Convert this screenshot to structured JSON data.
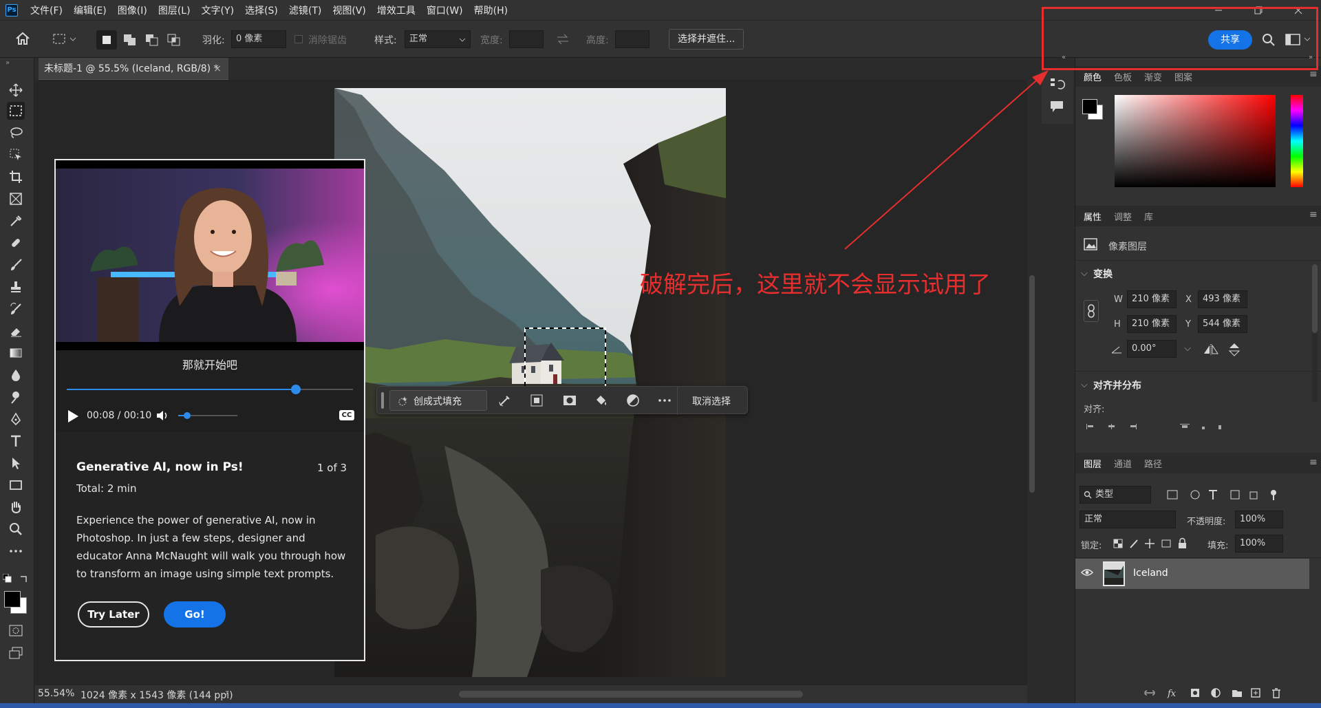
{
  "app": {
    "logo": "Ps",
    "menu": [
      "文件(F)",
      "编辑(E)",
      "图像(I)",
      "图层(L)",
      "文字(Y)",
      "选择(S)",
      "滤镜(T)",
      "视图(V)",
      "增效工具",
      "窗口(W)",
      "帮助(H)"
    ]
  },
  "options": {
    "feather_label": "羽化:",
    "feather_value": "0 像素",
    "antialias_label": "消除锯齿",
    "style_label": "样式:",
    "style_value": "正常",
    "width_label": "宽度:",
    "height_label": "高度:",
    "select_mask_button": "选择并遮住...",
    "share_button": "共享"
  },
  "document": {
    "tab_title": "未标题-1 @ 55.5% (Iceland, RGB/8) *",
    "zoom": "55.54%",
    "info": "1024 像素 x 1543 像素 (144 ppi)"
  },
  "context_bar": {
    "generative_fill": "创成式填充",
    "deselect": "取消选择"
  },
  "learn": {
    "video_caption": "那就开始吧",
    "time": "00:08 / 00:10",
    "progress": 0.8,
    "volume": 0.15,
    "cc": "CC",
    "title": "Generative AI, now in Ps!",
    "counter": "1 of 3",
    "total": "Total: 2 min",
    "description": "Experience the power of generative AI, now in Photoshop. In just a few steps, designer and educator Anna McNaught will walk you through how to transform an image using simple text prompts.",
    "try_later": "Try Later",
    "go": "Go!"
  },
  "color_panel": {
    "tabs": [
      "颜色",
      "色板",
      "渐变",
      "图案"
    ]
  },
  "properties": {
    "tabs": [
      "属性",
      "调整",
      "库"
    ],
    "layer_type": "像素图层",
    "transform": "变换",
    "w_label": "W",
    "w": "210 像素",
    "x_label": "X",
    "x": "493 像素",
    "h_label": "H",
    "h": "210 像素",
    "y_label": "Y",
    "y": "544 像素",
    "angle": "0.00°",
    "align_section": "对齐并分布",
    "align_label": "对齐:"
  },
  "layers": {
    "tabs": [
      "图层",
      "通道",
      "路径"
    ],
    "filter": "类型",
    "blend": "正常",
    "opacity_label": "不透明度:",
    "opacity": "100%",
    "lock_label": "锁定:",
    "fill_label": "填充:",
    "fill": "100%",
    "layer_name": "Iceland"
  },
  "annotation": "破解完后，这里就不会显示试用了",
  "colors": {
    "accent": "#1473e6",
    "annotation": "#e62e2e"
  }
}
